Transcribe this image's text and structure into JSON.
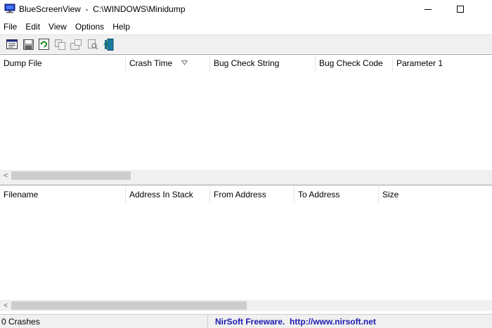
{
  "window": {
    "title": "BlueScreenView  -  C:\\WINDOWS\\Minidump"
  },
  "menu": [
    "File",
    "Edit",
    "View",
    "Options",
    "Help"
  ],
  "toolbar_icons": [
    "properties-icon",
    "save-icon",
    "refresh-icon",
    "copy-icon",
    "html-report-icon",
    "find-icon",
    "exit-icon"
  ],
  "upper_table": {
    "columns": [
      "Dump File",
      "Crash Time",
      "Bug Check String",
      "Bug Check Code",
      "Parameter 1"
    ],
    "sorted_column": "Crash Time"
  },
  "lower_table": {
    "columns": [
      "Filename",
      "Address In Stack",
      "From Address",
      "To Address",
      "Size"
    ]
  },
  "scrollbar_glyph": "<",
  "status": {
    "left": "0 Crashes",
    "right": "NirSoft Freeware.  http://www.nirsoft.net"
  },
  "colors": {
    "link_blue": "#1a1ab0",
    "chrome": "#f0f0f0"
  }
}
